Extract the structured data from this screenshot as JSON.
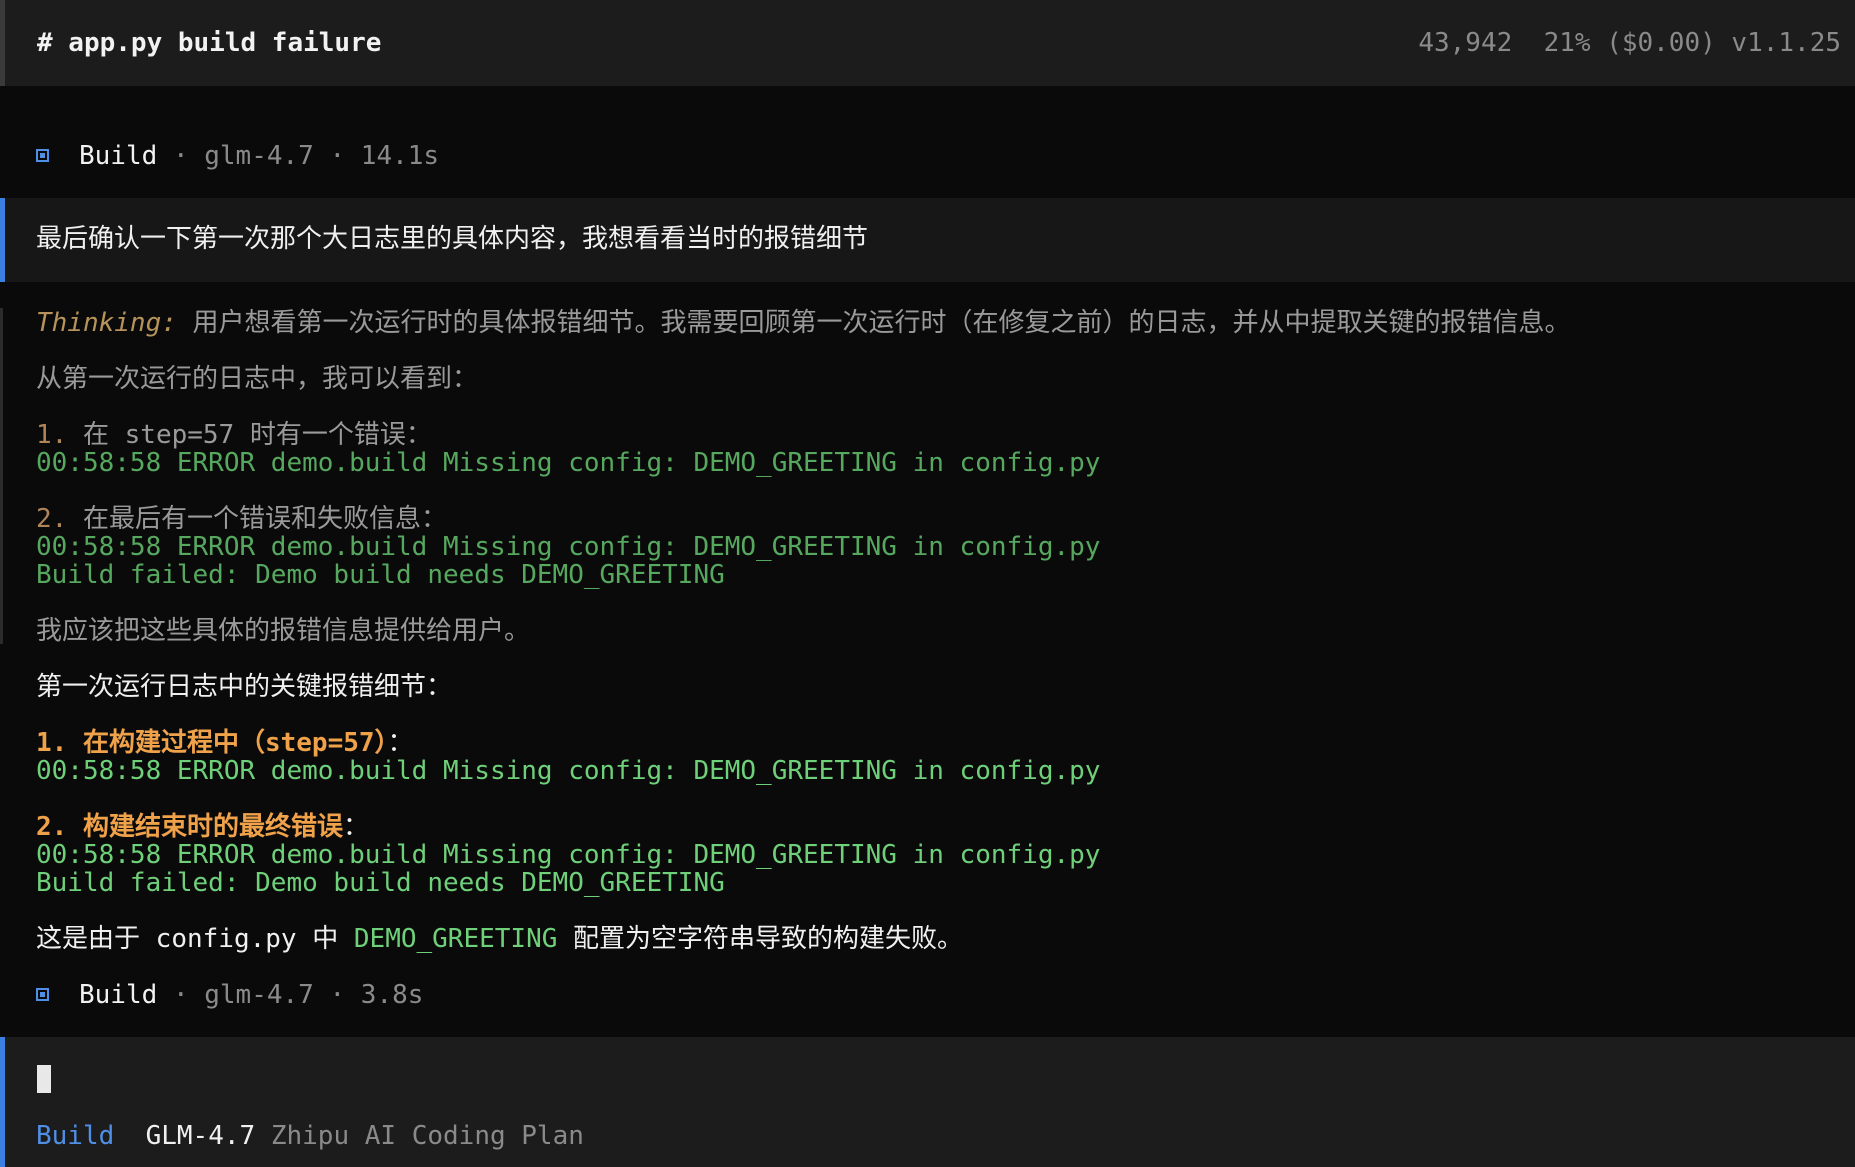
{
  "header": {
    "title": "# app.py build failure",
    "tokens": "43,942",
    "usage": "21% ($0.00)",
    "version": "v1.1.25"
  },
  "meta_top": {
    "icon": "square-bullet-icon",
    "agent": "Build",
    "sep": "·",
    "model": "glm-4.7",
    "duration": "14.1s"
  },
  "user_message": "最后确认一下第一次那个大日志里的具体内容，我想看看当时的报错细节",
  "thinking": {
    "label": "Thinking:",
    "intro": "用户想看第一次运行时的具体报错细节。我需要回顾第一次运行时（在修复之前）的日志，并从中提取关键的报错信息。",
    "from_log": "从第一次运行的日志中，我可以看到：",
    "item1_num": "1.",
    "item1_pre": "在",
    "item1_code": "step=57",
    "item1_post": "时有一个错误：",
    "item1_log": "00:58:58 ERROR demo.build Missing config: DEMO_GREETING in config.py",
    "item2_num": "2.",
    "item2_text": "在最后有一个错误和失败信息：",
    "item2_log1": "00:58:58 ERROR demo.build Missing config: DEMO_GREETING in config.py",
    "item2_log2": "Build failed: Demo build needs DEMO_GREETING",
    "conclusion": "我应该把这些具体的报错信息提供给用户。"
  },
  "answer": {
    "heading": "第一次运行日志中的关键报错细节：",
    "item1_title": "1. 在构建过程中（step=57）",
    "item1_colon": "：",
    "item1_log": "00:58:58 ERROR demo.build Missing config: DEMO_GREETING in config.py",
    "item2_title": "2. 构建结束时的最终错误",
    "item2_colon": "：",
    "item2_log1": "00:58:58 ERROR demo.build Missing config: DEMO_GREETING in config.py",
    "item2_log2": "Build failed: Demo build needs DEMO_GREETING",
    "summary_pre": "这是由于",
    "summary_file": "config.py",
    "summary_mid": "中",
    "summary_var": "DEMO_GREETING",
    "summary_post": "配置为空字符串导致的构建失败。"
  },
  "meta_bottom": {
    "icon": "square-bullet-icon",
    "agent": "Build",
    "sep": "·",
    "model": "glm-4.7",
    "duration": "3.8s"
  },
  "footer": {
    "mode": "Build",
    "model": "GLM-4.7",
    "provider": "Zhipu AI Coding Plan"
  },
  "colors": {
    "accent_blue": "#3b7fe0",
    "log_green": "#6fd07a",
    "heading_orange": "#f0a24a",
    "thinking_gold": "#b6935a"
  }
}
